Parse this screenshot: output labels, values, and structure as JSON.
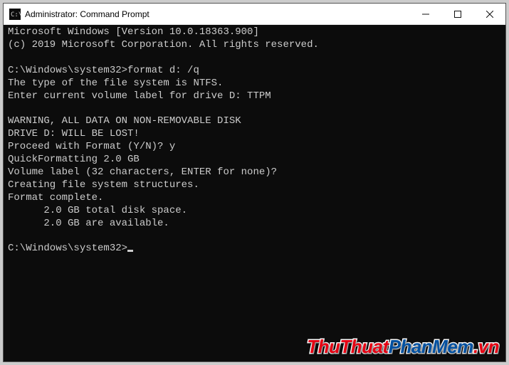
{
  "window": {
    "title": "Administrator: Command Prompt"
  },
  "terminal_lines": [
    "Microsoft Windows [Version 10.0.18363.900]",
    "(c) 2019 Microsoft Corporation. All rights reserved.",
    "",
    "C:\\Windows\\system32>format d: /q",
    "The type of the file system is NTFS.",
    "Enter current volume label for drive D: TTPM",
    "",
    "WARNING, ALL DATA ON NON-REMOVABLE DISK",
    "DRIVE D: WILL BE LOST!",
    "Proceed with Format (Y/N)? y",
    "QuickFormatting 2.0 GB",
    "Volume label (32 characters, ENTER for none)?",
    "Creating file system structures.",
    "Format complete.",
    "      2.0 GB total disk space.",
    "      2.0 GB are available.",
    ""
  ],
  "prompt_tail": "C:\\Windows\\system32>",
  "watermark": {
    "parts": [
      {
        "text": "ThuThuat",
        "color": "#e60012"
      },
      {
        "text": "PhanMem",
        "color": "#0050a0"
      },
      {
        "text": ".vn",
        "color": "#e60012"
      }
    ]
  }
}
